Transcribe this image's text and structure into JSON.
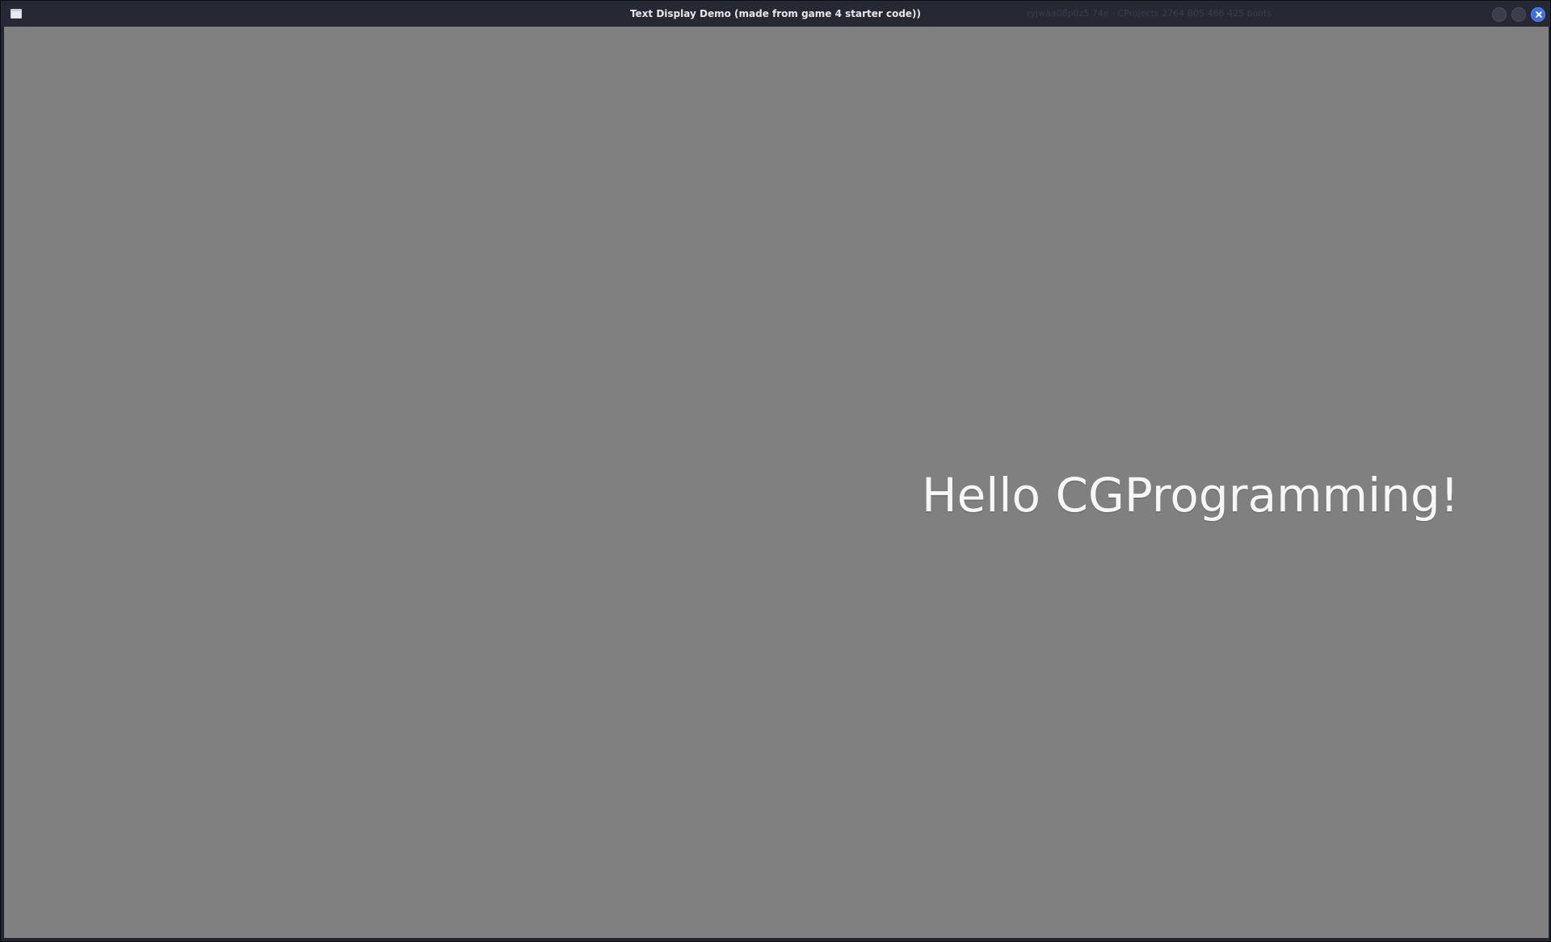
{
  "window": {
    "title": "Text Display Demo (made from game 4 starter code))",
    "secondary_title": "ryjwàa08p0z5 74e - CProjects 2764 B05 466 425 boots",
    "controls": {
      "minimize_icon": "circle-minimize-icon",
      "maximize_icon": "circle-maximize-icon",
      "close_icon": "close-x-icon",
      "close_color": "#3d6ee0"
    },
    "app_icon": "window-app-icon"
  },
  "canvas": {
    "background_color": "#808080",
    "text": "Hello CGProgramming!",
    "text_color": "#f6f6f6"
  }
}
